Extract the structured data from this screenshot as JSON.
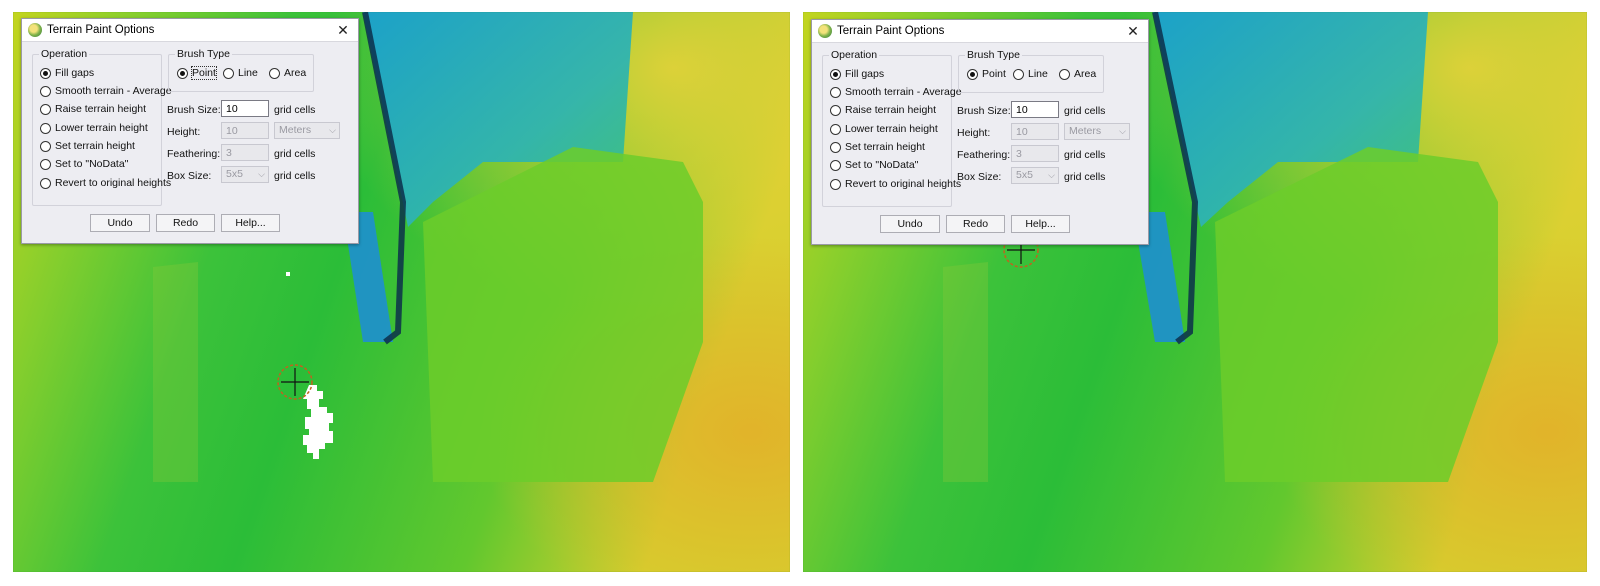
{
  "dialog": {
    "title": "Terrain Paint Options",
    "close_glyph": "✕",
    "icon": "globe-app-icon",
    "operation": {
      "label": "Operation",
      "options": [
        "Fill gaps",
        "Smooth terrain - Average",
        "Raise terrain height",
        "Lower terrain height",
        "Set terrain height",
        "Set to \"NoData\"",
        "Revert to original heights"
      ],
      "selected": "Fill gaps"
    },
    "brush_type": {
      "label": "Brush Type",
      "options": [
        "Point",
        "Line",
        "Area"
      ],
      "selected": "Point"
    },
    "fields": {
      "brush_size": {
        "label": "Brush Size:",
        "value": "10",
        "unit": "grid cells"
      },
      "height": {
        "label": "Height:",
        "value": "10",
        "unit": "Meters"
      },
      "feathering": {
        "label": "Feathering:",
        "value": "3",
        "unit": "grid cells"
      },
      "box_size": {
        "label": "Box Size:",
        "value": "5x5",
        "unit": "grid cells"
      }
    },
    "buttons": {
      "undo": "Undo",
      "redo": "Redo",
      "help": "Help..."
    }
  },
  "colors": {
    "terrain_low": "#1f8fd8",
    "terrain_mid": "#2fbf3a",
    "terrain_high": "#e8c12a",
    "gap_fill": "#ffffff",
    "cursor_ring": "#c0641e"
  }
}
